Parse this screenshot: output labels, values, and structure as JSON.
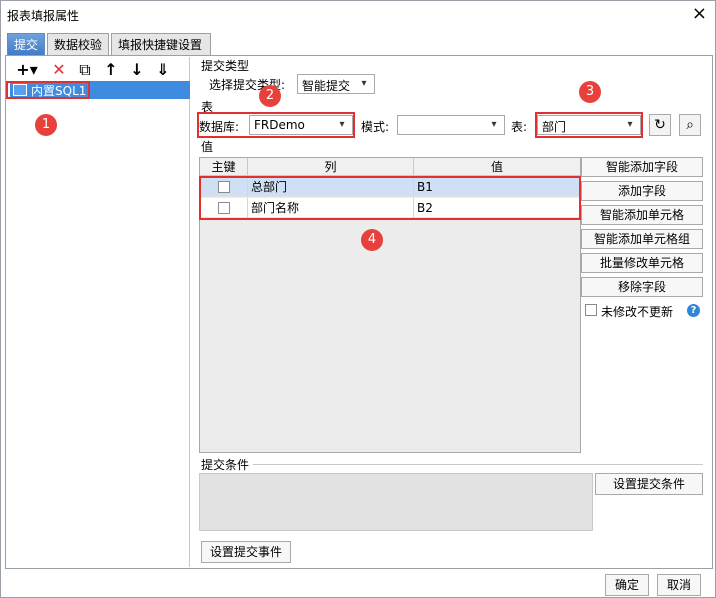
{
  "window": {
    "title": "报表填报属性"
  },
  "tabs": [
    {
      "label": "提交"
    },
    {
      "label": "数据校验"
    },
    {
      "label": "填报快捷键设置"
    }
  ],
  "toolbar": {
    "icons": [
      "add-icon",
      "delete-icon",
      "copy-icon",
      "move-up-icon",
      "move-down-icon",
      "sort-icon"
    ],
    "add_glyph": "+▾",
    "delete_glyph": "✕",
    "copy_glyph": "⧉",
    "up_glyph": "↑",
    "down_glyph": "↓",
    "sort_glyph": "⇓"
  },
  "tree": {
    "items": [
      {
        "label": "内置SQL1"
      }
    ]
  },
  "submit_type": {
    "section_label": "提交类型",
    "select_label": "选择提交类型:",
    "value": "智能提交"
  },
  "table_section": {
    "section_label": "表",
    "database_label": "数据库:",
    "database_value": "FRDemo",
    "schema_label": "模式:",
    "schema_value": "",
    "table_label": "表:",
    "table_value": "部门"
  },
  "values_section": {
    "section_label": "值",
    "columns": [
      "主键",
      "列",
      "值"
    ],
    "rows": [
      {
        "key": false,
        "column": "总部门",
        "value": "B1"
      },
      {
        "key": false,
        "column": "部门名称",
        "value": "B2"
      }
    ]
  },
  "side_buttons": {
    "smart_add_field": "智能添加字段",
    "add_field": "添加字段",
    "smart_add_cell": "智能添加单元格",
    "smart_add_cell_group": "智能添加单元格组",
    "batch_modify_cell": "批量修改单元格",
    "remove_field": "移除字段",
    "no_update_label": "未修改不更新",
    "help_glyph": "?"
  },
  "condition": {
    "section_label": "提交条件",
    "set_condition_button": "设置提交条件"
  },
  "set_event_button": "设置提交事件",
  "footer": {
    "ok": "确定",
    "cancel": "取消"
  },
  "annotations": [
    "1",
    "2",
    "3",
    "4"
  ],
  "colors": {
    "accent": "#3f8be0",
    "highlight": "#e03030",
    "badge": "#e8413b"
  }
}
